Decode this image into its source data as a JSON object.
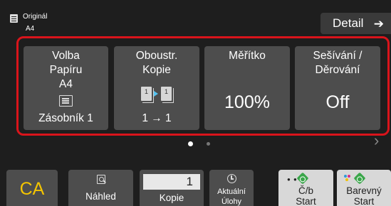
{
  "original": {
    "label": "Originál",
    "size": "A4"
  },
  "detail": {
    "label": "Detail",
    "arrow": "➔"
  },
  "tiles": {
    "paper": {
      "line1": "Volba",
      "line2": "Papíru",
      "line3": "A4",
      "tray": "Zásobník 1"
    },
    "duplex": {
      "line1": "Oboustr.",
      "line2": "Kopie",
      "mode": "1 → 1",
      "page_a": "1",
      "page_b": "1"
    },
    "ratio": {
      "label": "Měřítko",
      "value": "100%"
    },
    "finish": {
      "line1": "Sešívání /",
      "line2": "Děrování",
      "value": "Off"
    }
  },
  "pager": {
    "next": "›"
  },
  "bottom": {
    "ca": "CA",
    "preview": "Náhled",
    "copies_value": "1",
    "copies_label": "Kopie",
    "tasks_line1": "Aktuální",
    "tasks_line2": "Úlohy",
    "bw_line1": "Č/b",
    "bw_line2": "Start",
    "color_line1": "Barevný",
    "color_line2": "Start"
  },
  "colors": {
    "frame": "#d9141b",
    "ca_text": "#f4c500",
    "start_diamond": "#3aa64a"
  }
}
